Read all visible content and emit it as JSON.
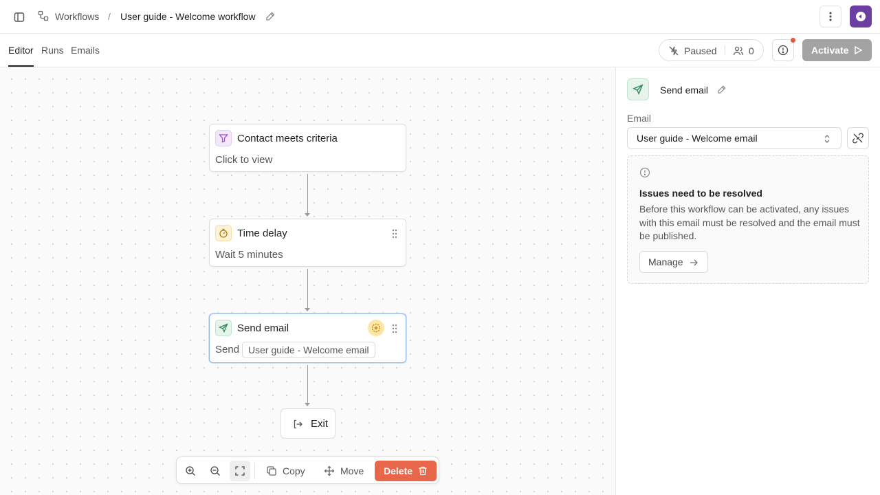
{
  "header": {
    "breadcrumb_root": "Workflows",
    "breadcrumb_sep": "/",
    "breadcrumb_current": "User guide - Welcome workflow"
  },
  "tabs": [
    {
      "label": "Editor",
      "active": true
    },
    {
      "label": "Runs",
      "active": false
    },
    {
      "label": "Emails",
      "active": false
    }
  ],
  "status": {
    "label": "Paused",
    "contacts_count": "0"
  },
  "actions": {
    "activate_label": "Activate"
  },
  "flow": {
    "trigger": {
      "title": "Contact meets criteria",
      "subtitle": "Click to view",
      "icon": "filter-icon"
    },
    "delay": {
      "title": "Time delay",
      "subtitle": "Wait 5 minutes",
      "icon": "timer-icon"
    },
    "send": {
      "title": "Send email",
      "prefix": "Send",
      "email": "User guide - Welcome email",
      "icon": "send-icon"
    },
    "exit": {
      "label": "Exit"
    }
  },
  "toolbar": {
    "copy_label": "Copy",
    "move_label": "Move",
    "delete_label": "Delete"
  },
  "panel": {
    "title": "Send email",
    "email_label": "Email",
    "email_value": "User guide - Welcome email",
    "issue_title": "Issues need to be resolved",
    "issue_body": "Before this workflow can be activated, any issues with this email must be resolved and the email must be published.",
    "manage_label": "Manage"
  },
  "colors": {
    "accent_delete": "#e8674a",
    "activate_disabled": "#a3a3a3",
    "avatar": "#6b3fa0",
    "notification_dot": "#e8553a"
  }
}
